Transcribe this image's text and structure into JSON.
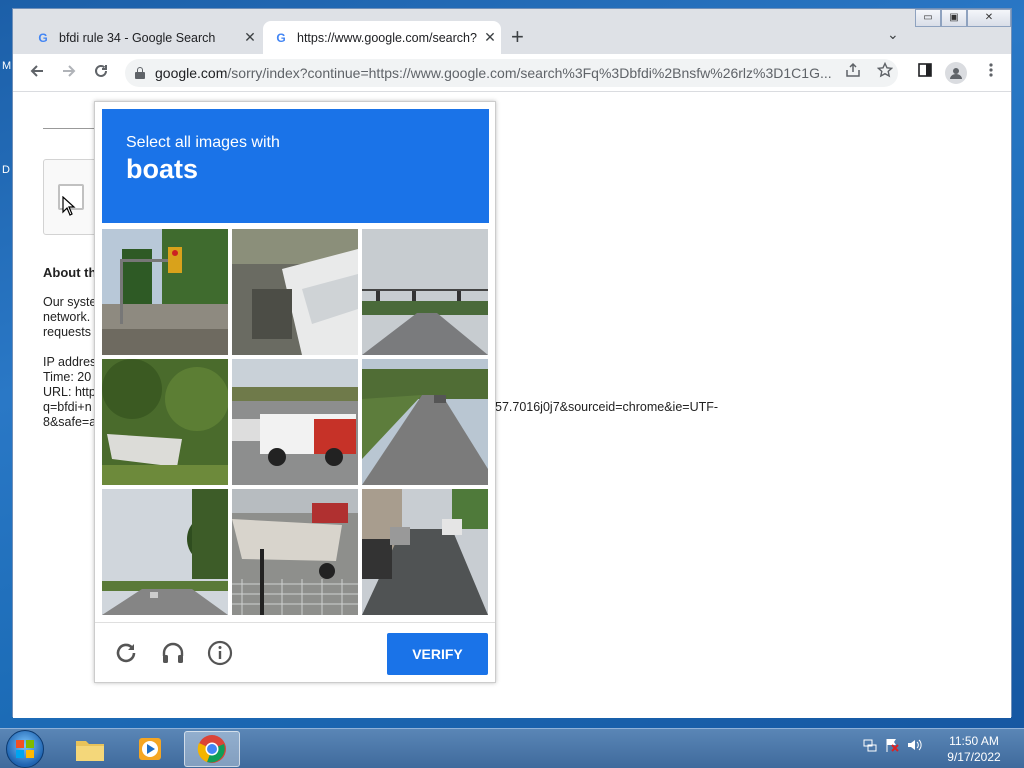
{
  "desktop": {
    "left_letters": [
      "M",
      "D"
    ]
  },
  "window_controls": {
    "minimize": "▭",
    "restore": "▣",
    "close": "✕"
  },
  "tabs": [
    {
      "title": "bfdi rule 34 - Google Search",
      "close": "✕"
    },
    {
      "title": "https://www.google.com/search?",
      "close": "✕"
    }
  ],
  "new_tab_label": "+",
  "tab_search_label": "⌄",
  "address_bar": {
    "domain": "google.com",
    "path": "/sorry/index?continue=https://www.google.com/search%3Fq%3Dbfdi%2Bnsfw%26rlz%3D1C1G..."
  },
  "page": {
    "about_heading": "About th",
    "para_lines": [
      "Our syste",
      "network.",
      "requests"
    ],
    "ip_line": "IP addres",
    "time_line": "Time: 20",
    "url_lines": [
      "URL: http",
      "q=bfdi+n",
      "8&safe=a"
    ],
    "url_overflow_line1": "57.7016j0j7&sourceid=chrome&ie=UTF-",
    "url_overflow_line2": "8&safe=a"
  },
  "captcha": {
    "instruction": "Select all images with",
    "target": "boats",
    "verify_label": "VERIFY",
    "tiles": [
      "intersection-traffic-light",
      "boat-closeup",
      "road-traffic-lights",
      "boat-in-bushes",
      "intersection-pickup-truck",
      "highway-car",
      "road-trees",
      "boat-on-trailer",
      "street-parked-cars"
    ]
  },
  "icons": {
    "back": "back-arrow-icon",
    "forward": "forward-arrow-icon",
    "reload": "reload-icon",
    "share": "share-icon",
    "bookmark": "star-icon",
    "sidepanel": "side-panel-icon",
    "profile": "profile-icon",
    "menu": "kebab-menu-icon"
  },
  "colors": {
    "accent": "#1a73e8",
    "tabstrip": "#dee1e6"
  },
  "taskbar": {
    "clock_time": "11:50 AM",
    "clock_date": "9/17/2022"
  }
}
